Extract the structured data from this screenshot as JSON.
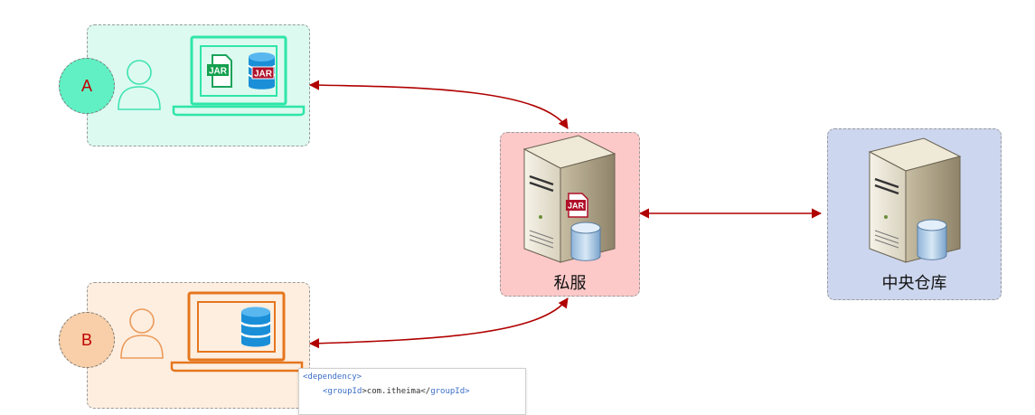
{
  "nodes": {
    "developer_a": {
      "label": "A"
    },
    "developer_b": {
      "label": "B"
    },
    "private_server": {
      "label": "私服"
    },
    "central_repo": {
      "label": "中央仓库"
    }
  },
  "file_icons": {
    "jar": "JAR"
  },
  "code_snippet": {
    "line1_open": "<",
    "line1_tag": "dependency",
    "line1_close": ">",
    "line2_open": "<",
    "line2_tag": "groupId",
    "line2_mid": ">com.itheima</",
    "line2_tag2": "groupId",
    "line2_close": ">"
  },
  "colors": {
    "panel_a": "#dcfaf0",
    "panel_b": "#fdeee0",
    "panel_private": "#fcc8c8",
    "panel_central": "#ccd6ee",
    "laptop_a": "#2fe6a8",
    "laptop_b": "#e5761e",
    "arrow": "#b00000",
    "database": "#1a8fd8"
  }
}
